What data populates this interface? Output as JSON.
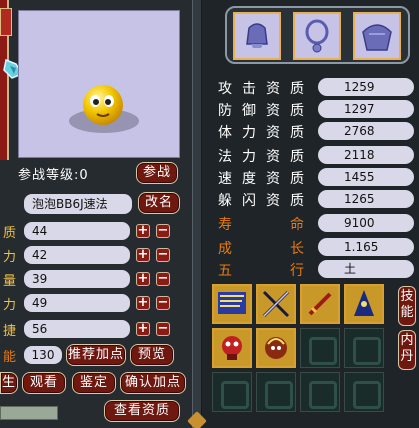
{
  "left": {
    "battle_level_label": "参战等级:0",
    "battle_button": "参战",
    "pet_name": "泡泡BB6J速法",
    "rename_button": "改名",
    "attributes": [
      {
        "label": "质",
        "value": "44"
      },
      {
        "label": "力",
        "value": "42"
      },
      {
        "label": "量",
        "value": "39"
      },
      {
        "label": "力",
        "value": "49"
      },
      {
        "label": "捷",
        "value": "56"
      }
    ],
    "points_label": "能",
    "points_value": "130",
    "recommend_button": "推荐加点",
    "preview_button": "预览",
    "bottom_buttons": [
      "生",
      "观看",
      "鉴定",
      "确认加点"
    ],
    "view_aptitude_button": "查看资质"
  },
  "right": {
    "aptitudes": [
      {
        "label": "攻击资质",
        "value": "1259",
        "color": "#ffffff"
      },
      {
        "label": "防御资质",
        "value": "1297",
        "color": "#ffffff"
      },
      {
        "label": "体力资质",
        "value": "2768",
        "color": "#ffffff"
      },
      {
        "label": "法力资质",
        "value": "2118",
        "color": "#ffffff"
      },
      {
        "label": "速度资质",
        "value": "1455",
        "color": "#ffffff"
      },
      {
        "label": "躲闪资质",
        "value": "1265",
        "color": "#ffffff"
      }
    ],
    "growth": [
      {
        "label": "寿",
        "label2": "命",
        "value": "9100"
      },
      {
        "label": "成",
        "label2": "长",
        "value": "1.165"
      },
      {
        "label": "五",
        "label2": "行",
        "value": "土"
      }
    ],
    "tabs": [
      "技能",
      "内丹"
    ],
    "equipment": [
      "helmet-icon",
      "necklace-icon",
      "armor-icon"
    ],
    "skills": [
      "book-skill-icon",
      "crossed-blades-icon",
      "sword-skill-icon",
      "wizard-icon",
      "skull-icon",
      "spirit-head-icon"
    ]
  },
  "colors": {
    "button_red": "#6e1810",
    "field_bg": "#d8d8e8",
    "accent_orange": "#e87a10",
    "preview_bg": "#c6c3e6"
  }
}
